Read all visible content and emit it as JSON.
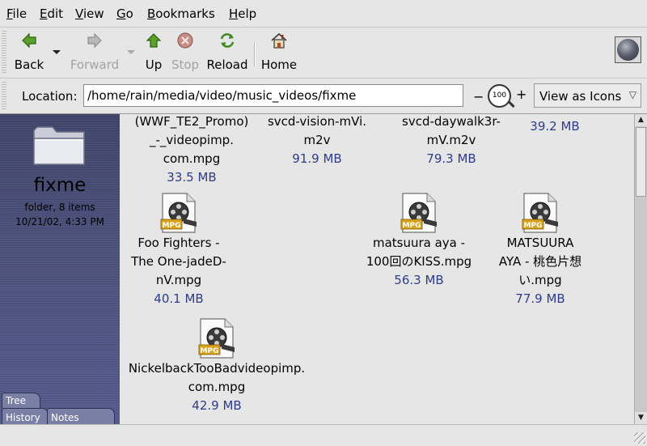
{
  "menubar": {
    "items": [
      "File",
      "Edit",
      "View",
      "Go",
      "Bookmarks",
      "Help"
    ]
  },
  "toolbar": {
    "back": "Back",
    "forward": "Forward",
    "up": "Up",
    "stop": "Stop",
    "reload": "Reload",
    "home": "Home"
  },
  "location": {
    "label": "Location:",
    "path": "/home/rain/media/video/music_videos/fixme",
    "zoom_out": "−",
    "zoom_level": "100",
    "zoom_in": "+",
    "view_as": "View as Icons",
    "view_arrow": "▽"
  },
  "sidebar": {
    "folder_name": "fixme",
    "folder_info": "folder, 8 items",
    "folder_date": "10/21/02, 4:33 PM",
    "tabs": [
      "Tree",
      "History",
      "Notes"
    ]
  },
  "files": [
    {
      "lines": [
        "(WWF_TE2_Promo)",
        "_-_videopimp.",
        "com.mpg"
      ],
      "size": "33.5 MB",
      "icon": "mpg-video-icon",
      "icon_visible": false
    },
    {
      "lines": [
        "svcd-vision-mVi.",
        "m2v"
      ],
      "size": "91.9 MB",
      "icon": "mpg-video-icon",
      "icon_visible": false
    },
    {
      "lines": [
        "svcd-daywalk3r-",
        "mV.m2v"
      ],
      "size": "79.3 MB",
      "icon": "mpg-video-icon",
      "icon_visible": false
    },
    {
      "lines": [],
      "size": "39.2 MB",
      "icon": "mpg-video-icon",
      "icon_visible": false
    },
    {
      "lines": [
        "Foo Fighters -",
        "The One-jadeD-",
        "nV.mpg"
      ],
      "size": "40.1 MB",
      "icon": "mpg-video-icon",
      "icon_visible": true
    },
    {
      "lines": [
        "matsuura aya -",
        "100回のKISS.mpg"
      ],
      "size": "56.3 MB",
      "icon": "mpg-video-icon",
      "icon_visible": true
    },
    {
      "lines": [
        "MATSUURA",
        "AYA - 桃色片想",
        "い.mpg"
      ],
      "size": "77.9 MB",
      "icon": "mpg-video-icon",
      "icon_visible": true
    },
    {
      "lines": [
        "NickelbackTooBadvideopimp.",
        "com.mpg"
      ],
      "size": "42.9 MB",
      "icon": "mpg-video-icon",
      "icon_visible": true
    }
  ],
  "icon_badge": "MPG",
  "colors": {
    "size_text": "#2f3c8a",
    "sidebar_bg": "#4a4f78"
  },
  "scrollbar": {
    "up_arrow": "▲",
    "down_arrow": "▼"
  }
}
